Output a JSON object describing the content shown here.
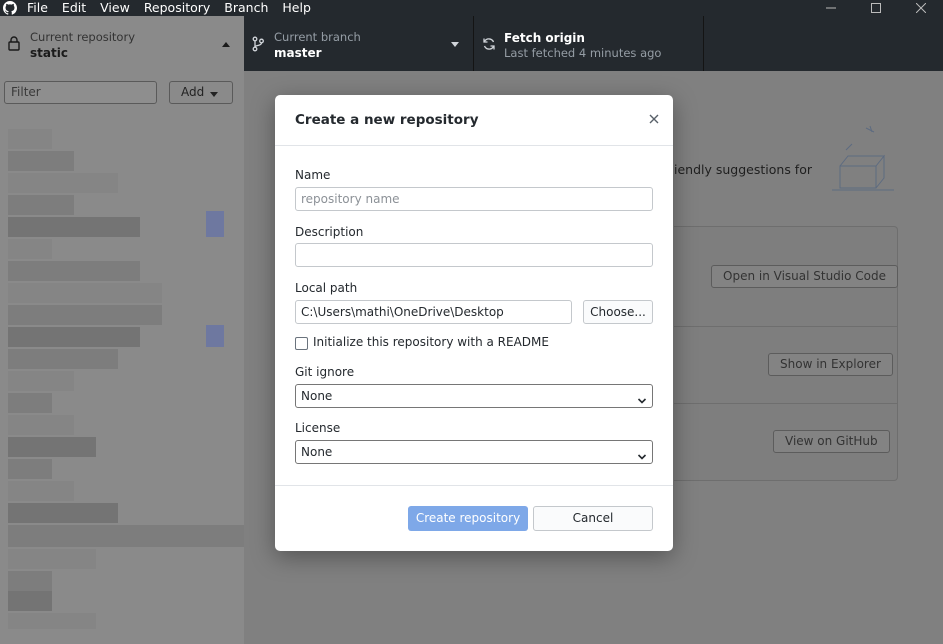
{
  "menubar": {
    "items": [
      "File",
      "Edit",
      "View",
      "Repository",
      "Branch",
      "Help"
    ],
    "window_controls": [
      "minimize-icon",
      "maximize-icon",
      "close-icon"
    ]
  },
  "toolbar": {
    "repo": {
      "label": "Current repository",
      "value": "static"
    },
    "branch": {
      "label": "Current branch",
      "value": "master"
    },
    "fetch": {
      "label": "Fetch origin",
      "value": "Last fetched 4 minutes ago"
    }
  },
  "sidebar": {
    "filter_placeholder": "Filter",
    "add_label": "Add"
  },
  "background": {
    "suggestion_text": "iendly suggestions for",
    "actions": [
      "Open in Visual Studio Code",
      "Show in Explorer",
      "View on GitHub"
    ]
  },
  "dialog": {
    "title": "Create a new repository",
    "name_label": "Name",
    "name_placeholder": "repository name",
    "description_label": "Description",
    "description_value": "",
    "local_path_label": "Local path",
    "local_path_value": "C:\\Users\\mathi\\OneDrive\\Desktop",
    "choose_label": "Choose...",
    "readme_label": "Initialize this repository with a README",
    "readme_checked": false,
    "gitignore_label": "Git ignore",
    "gitignore_value": "None",
    "license_label": "License",
    "license_value": "None",
    "create_label": "Create repository",
    "cancel_label": "Cancel"
  },
  "colors": {
    "titlebar": "#24292e",
    "primary_button": "#7ea8e8",
    "overlay": "#808080"
  }
}
